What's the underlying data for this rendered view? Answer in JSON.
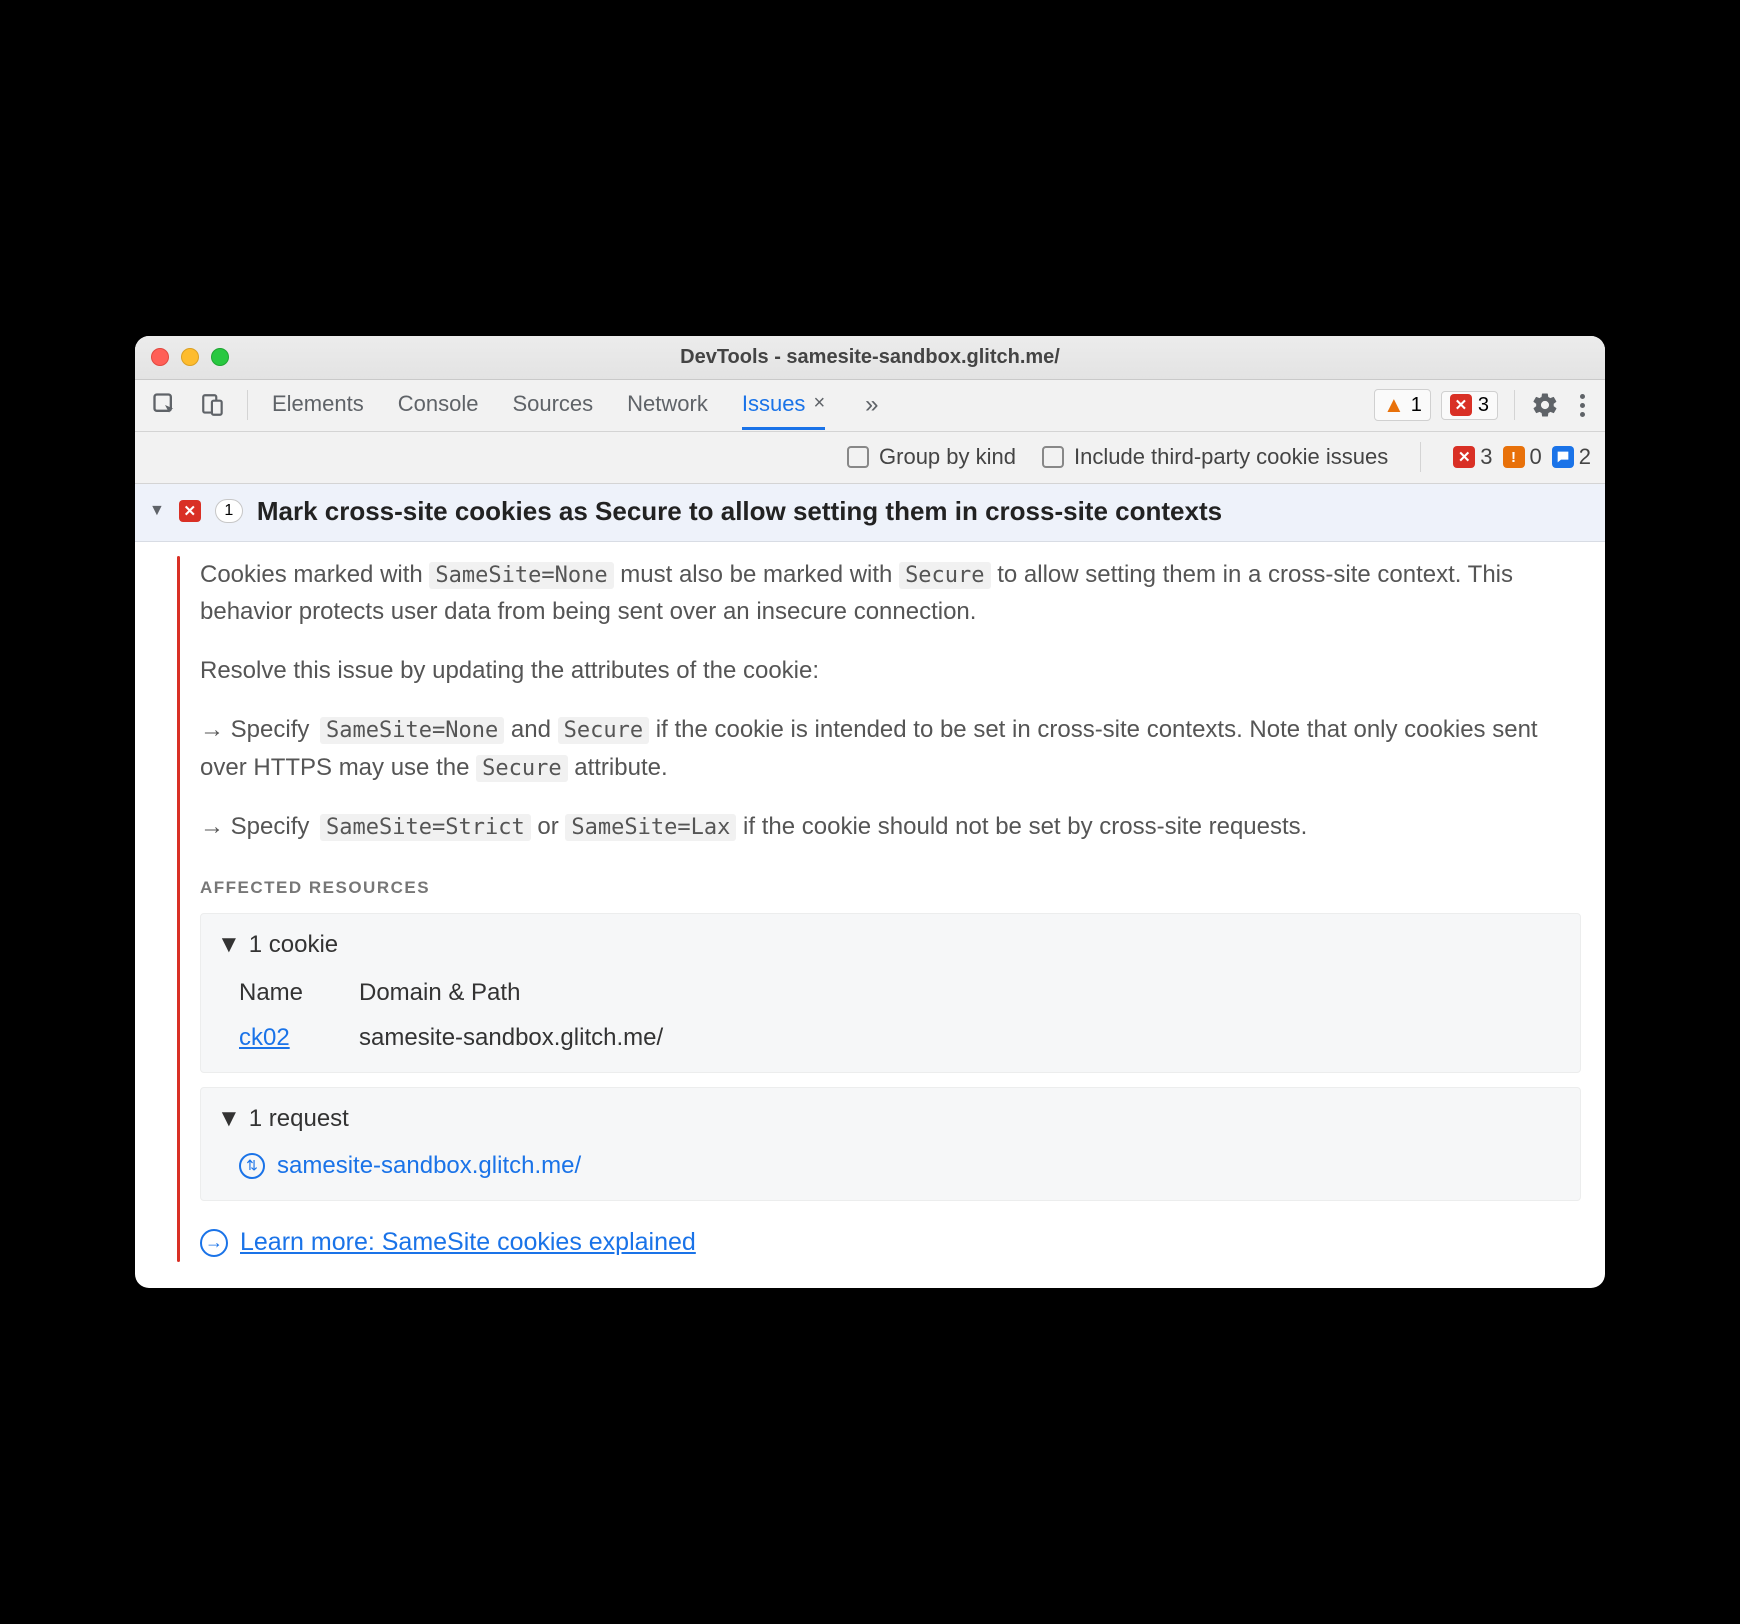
{
  "window": {
    "title": "DevTools - samesite-sandbox.glitch.me/"
  },
  "tabs": {
    "items": [
      "Elements",
      "Console",
      "Sources",
      "Network"
    ],
    "active": {
      "label": "Issues",
      "close": "×"
    },
    "overflow": "»"
  },
  "toolbar_right": {
    "warnings": "1",
    "errors": "3"
  },
  "filterbar": {
    "group_by_kind": "Group by kind",
    "include_third_party": "Include third-party cookie issues",
    "counts": {
      "errors": "3",
      "warnings": "0",
      "info": "2"
    }
  },
  "issue": {
    "count": "1",
    "title": "Mark cross-site cookies as Secure to allow setting them in cross-site contexts",
    "desc_prefix": "Cookies marked with ",
    "code_samesite_none": "SameSite=None",
    "desc_mid": " must also be marked with ",
    "code_secure": "Secure",
    "desc_suffix": " to allow setting them in a cross-site context. This behavior protects user data from being sent over an insecure connection.",
    "resolve": "Resolve this issue by updating the attributes of the cookie:",
    "b1_pre": "→ Specify ",
    "b1_mid": " and ",
    "b1_post": " if the cookie is intended to be set in cross-site contexts. Note that only cookies sent over HTTPS may use the ",
    "b1_end": " attribute.",
    "b2_pre": "→ Specify ",
    "code_samesite_strict": "SameSite=Strict",
    "b2_mid": " or ",
    "code_samesite_lax": "SameSite=Lax",
    "b2_post": " if the cookie should not be set by cross-site requests.",
    "affected_label": "AFFECTED RESOURCES",
    "cookie_header": "1 cookie",
    "cookie_columns": {
      "name": "Name",
      "domain": "Domain & Path"
    },
    "cookie_row": {
      "name": "ck02",
      "domain": "samesite-sandbox.glitch.me/"
    },
    "request_header": "1 request",
    "request_url": "samesite-sandbox.glitch.me/",
    "learn_more": "Learn more: SameSite cookies explained"
  }
}
